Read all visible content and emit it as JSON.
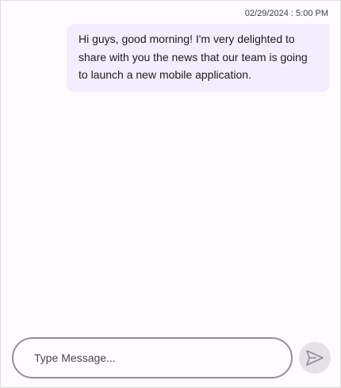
{
  "message": {
    "timestamp": "02/29/2024 : 5:00 PM",
    "text": "Hi guys, good morning! I'm very delighted to share with you the news that our team is going to launch a new mobile application."
  },
  "composer": {
    "placeholder": "Type Message..."
  },
  "send": {
    "icon": "send-icon"
  },
  "colors": {
    "bubble": "#f3eefd",
    "background": "#fdfbff",
    "send_button": "#e6e0e9",
    "input_border": "#958f99"
  }
}
